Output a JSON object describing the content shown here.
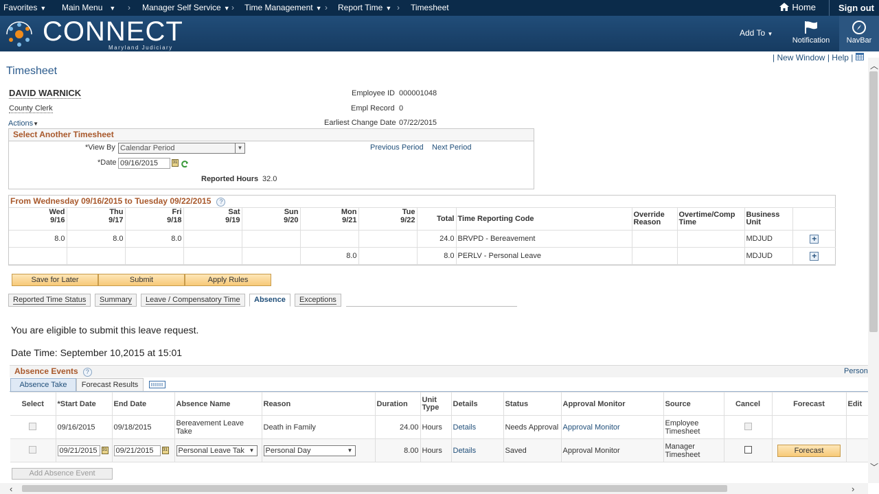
{
  "topnav": {
    "favorites": "Favorites",
    "main_menu": "Main Menu",
    "crumbs": [
      "Manager Self Service",
      "Time Management",
      "Report Time",
      "Timesheet"
    ],
    "home": "Home",
    "sign_out": "Sign out"
  },
  "banner": {
    "logo_text": "CONNECT",
    "logo_sub": "Maryland Judiciary",
    "add_to": "Add To",
    "notification": "Notification",
    "navbar": "NavBar"
  },
  "links": {
    "new_window": "New Window",
    "help": "Help"
  },
  "page_title": "Timesheet",
  "employee": {
    "name": "DAVID WARNICK",
    "title": "County Clerk",
    "actions": "Actions",
    "id_label": "Employee ID",
    "id_value": "000001048",
    "rec_label": "Empl Record",
    "rec_value": "0",
    "ecd_label": "Earliest Change Date",
    "ecd_value": "07/22/2015"
  },
  "select_ts": {
    "header": "Select Another Timesheet",
    "viewby_label": "*View By",
    "viewby_value": "Calendar Period",
    "date_label": "*Date",
    "date_value": "09/16/2015",
    "prev": "Previous Period",
    "next": "Next Period",
    "rep_label": "Reported Hours",
    "rep_value": "32.0"
  },
  "period": {
    "header": "From Wednesday 09/16/2015 to Tuesday 09/22/2015",
    "days": [
      {
        "d": "Wed",
        "dt": "9/16"
      },
      {
        "d": "Thu",
        "dt": "9/17"
      },
      {
        "d": "Fri",
        "dt": "9/18"
      },
      {
        "d": "Sat",
        "dt": "9/19"
      },
      {
        "d": "Sun",
        "dt": "9/20"
      },
      {
        "d": "Mon",
        "dt": "9/21"
      },
      {
        "d": "Tue",
        "dt": "9/22"
      }
    ],
    "col_total": "Total",
    "col_trc": "Time Reporting Code",
    "col_override_1": "Override",
    "col_override_2": "Reason",
    "col_ot_1": "Overtime/Comp",
    "col_ot_2": "Time",
    "col_bu_1": "Business",
    "col_bu_2": "Unit",
    "rows": [
      {
        "h": [
          "8.0",
          "8.0",
          "8.0",
          "",
          "",
          "",
          ""
        ],
        "total": "24.0",
        "trc": "BRVPD - Bereavement",
        "bu": "MDJUD"
      },
      {
        "h": [
          "",
          "",
          "",
          "",
          "",
          "8.0",
          ""
        ],
        "total": "8.0",
        "trc": "PERLV - Personal Leave",
        "bu": "MDJUD"
      }
    ]
  },
  "buttons": {
    "save": "Save for Later",
    "submit": "Submit",
    "apply": "Apply Rules"
  },
  "tabs": [
    "Reported Time Status",
    "Summary",
    "Leave / Compensatory Time",
    "Absence",
    "Exceptions"
  ],
  "msg1": "You are eligible to submit this leave request.",
  "msg2": "Date Time: September 10,2015 at 15:01",
  "absence": {
    "header": "Absence Events",
    "right_link": "Person",
    "subtabs": [
      "Absence Take",
      "Forecast Results"
    ],
    "cols": [
      "Select",
      "*Start Date",
      "End Date",
      "Absence Name",
      "Reason",
      "Duration",
      "Unit",
      "Type",
      "Details",
      "Status",
      "Approval Monitor",
      "Source",
      "Cancel",
      "Forecast",
      "Edit"
    ],
    "rows": [
      {
        "start": "09/16/2015",
        "end": "09/18/2015",
        "name": "Bereavement Leave Take",
        "reason": "Death in Family",
        "dur": "24.00",
        "unit": "Hours",
        "details": "Details",
        "status": "Needs Approval",
        "monitor": "Approval Monitor",
        "source1": "Employee",
        "source2": "Timesheet"
      },
      {
        "start": "09/21/2015",
        "end": "09/21/2015",
        "name": "Personal Leave Tak",
        "reason": "Personal Day",
        "dur": "8.00",
        "unit": "Hours",
        "details": "Details",
        "status": "Saved",
        "monitor": "Approval Monitor",
        "source1": "Manager",
        "source2": "Timesheet",
        "forecast": "Forecast"
      }
    ],
    "add_btn": "Add Absence Event"
  },
  "colors": {
    "nav": "#0b2b4a",
    "banner": "#1d4670",
    "accent": "#a8582b",
    "link": "#1f4e79"
  }
}
